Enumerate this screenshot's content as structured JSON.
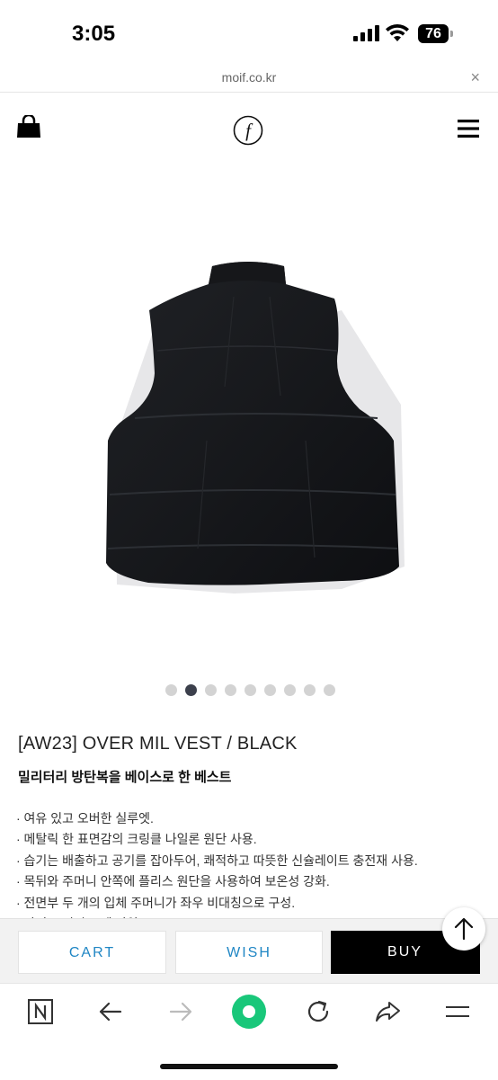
{
  "status_bar": {
    "time": "3:05",
    "battery": "76"
  },
  "url_bar": {
    "url": "moif.co.kr",
    "close": "×"
  },
  "header": {
    "logo_letter": "f"
  },
  "product": {
    "image_count": 9,
    "active_image_index": 1,
    "title": "[AW23] OVER MIL VEST / BLACK",
    "subtitle": "밀리터리 방탄복을 베이스로 한 베스트",
    "features": [
      "· 여유 있고 오버한 실루엣.",
      "· 메탈릭 한 표면감의 크링클 나일론 원단 사용.",
      "· 습기는 배출하고 공기를 잡아두어, 쾌적하고 따뜻한 신슐레이트 충전재 사용.",
      "· 목뒤와 주머니 안쪽에 플리스 원단을 사용하여 보온성 강화.",
      "· 전면부 두 개의 입체 주머니가 좌우 비대칭으로 구성.",
      "· 사이드 지퍼 포켓 사양."
    ]
  },
  "actions": {
    "cart": "CART",
    "wish": "WISH",
    "buy": "BUY"
  },
  "colors": {
    "accent": "#1f86c4",
    "buy_bg": "#000000",
    "active_dot": "#3c404c",
    "reload_green": "#19c77a"
  }
}
